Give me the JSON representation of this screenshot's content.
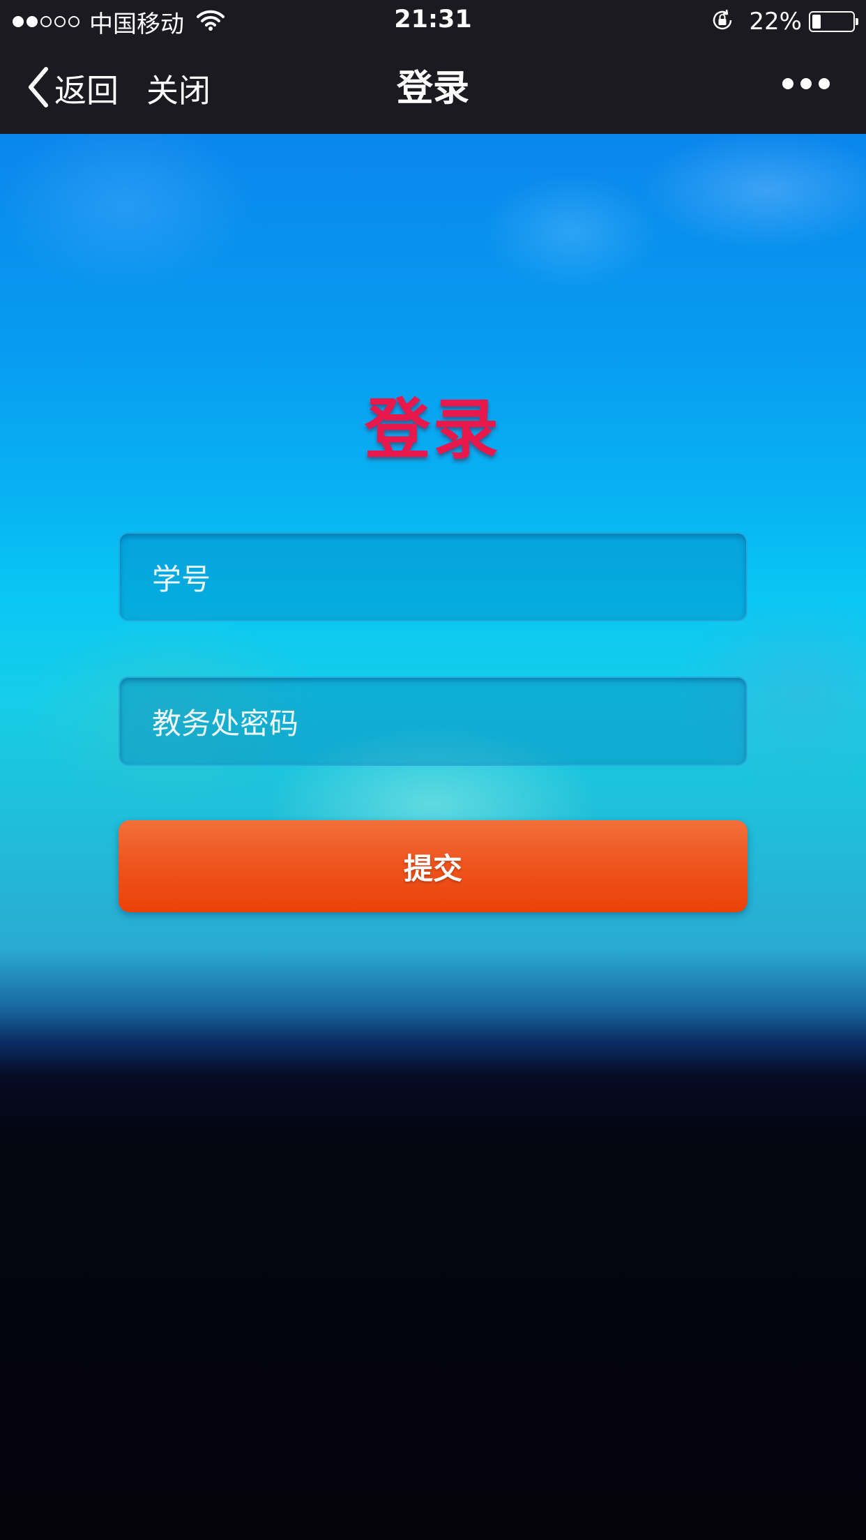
{
  "status_bar": {
    "carrier": "中国移动",
    "time": "21:31",
    "battery_percent_text": "22%",
    "battery_level": 0.22,
    "signal_bars_filled": 2,
    "signal_bars_total": 5
  },
  "nav_bar": {
    "back_label": "返回",
    "close_label": "关闭",
    "title": "登录",
    "more_icon": "more-dots-icon"
  },
  "login": {
    "heading": "登录",
    "student_id_placeholder": "学号",
    "password_placeholder": "教务处密码",
    "submit_label": "提交"
  },
  "colors": {
    "heading": "#e8174c",
    "submit": "#ef5520",
    "nav_background": "#1b1a20"
  }
}
